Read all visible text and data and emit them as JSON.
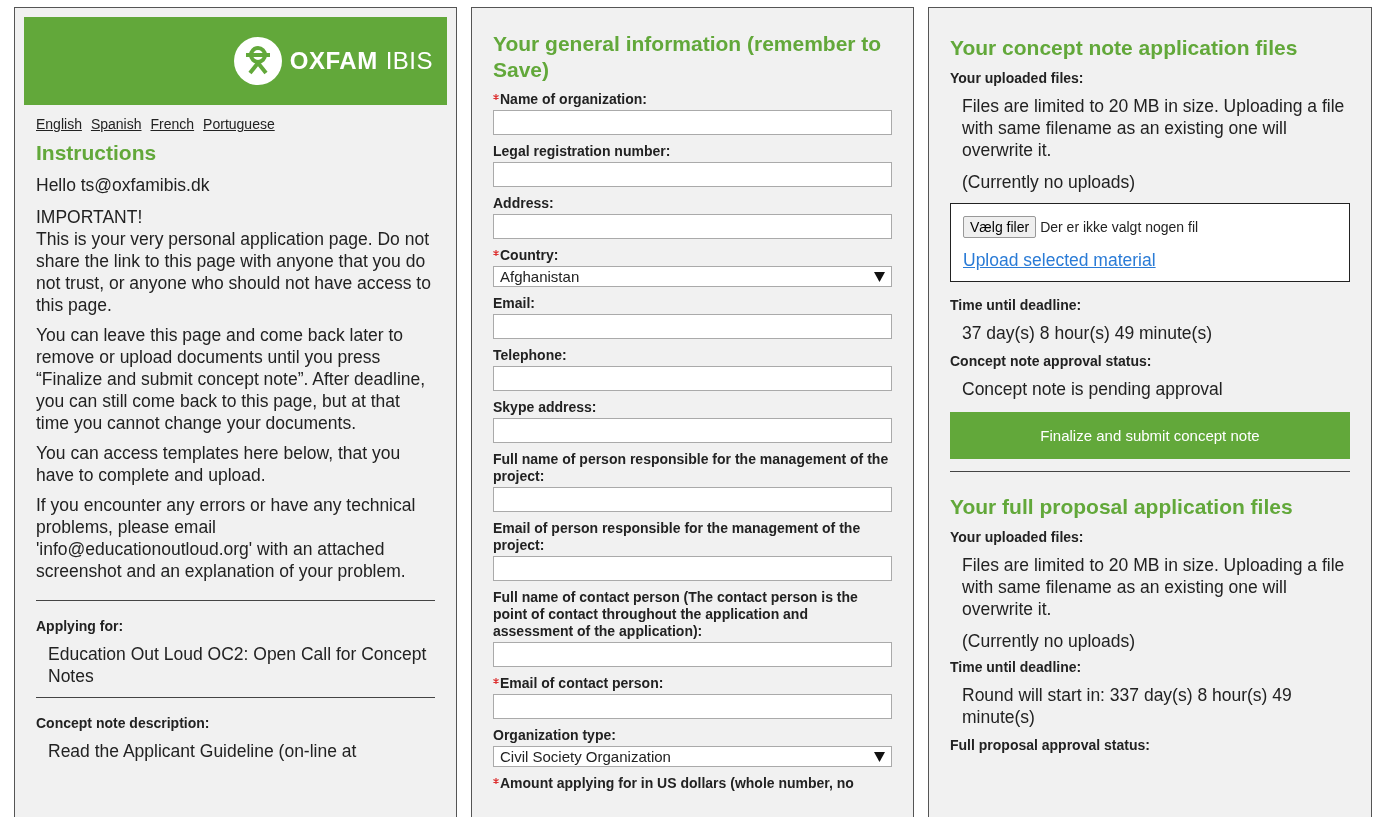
{
  "left": {
    "logo": {
      "word1": "OXFAM",
      "word2": "IBIS"
    },
    "languages": [
      "English",
      "Spanish",
      "French",
      "Portuguese"
    ],
    "heading": "Instructions",
    "greeting": "Hello ts@oxfamibis.dk",
    "important": "IMPORTANT!",
    "paragraphs": [
      "This is your very personal application page. Do not share the link to this page with anyone that you do not trust, or anyone who should not have access to this page.",
      "You can leave this page and come back later to remove or upload documents until you press “Finalize and submit concept note”. After deadline, you can still come back to this page, but at that time you cannot change your documents.",
      "You can access templates here below, that you have to complete and upload.",
      "If you encounter any errors or have any technical problems, please email 'info@educationoutloud.org' with an attached screenshot and an explanation of your problem."
    ],
    "sections": [
      {
        "label": "Applying for:",
        "value": "Education Out Loud OC2: Open Call for Concept Notes"
      },
      {
        "label": "Concept note description:",
        "value": "Read the Applicant Guideline (on-line at"
      }
    ]
  },
  "middle": {
    "heading": "Your general information (remember to Save)",
    "fields": [
      {
        "kind": "text",
        "label": "Name of organization:",
        "required": true
      },
      {
        "kind": "text",
        "label": "Legal registration number:",
        "required": false
      },
      {
        "kind": "text",
        "label": "Address:",
        "required": false
      },
      {
        "kind": "select",
        "label": "Country:",
        "required": true,
        "value": "Afghanistan"
      },
      {
        "kind": "text",
        "label": "Email:",
        "required": false
      },
      {
        "kind": "text",
        "label": "Telephone:",
        "required": false
      },
      {
        "kind": "text",
        "label": "Skype address:",
        "required": false
      },
      {
        "kind": "text",
        "label": "Full name of person responsible for the management of the project:",
        "required": false
      },
      {
        "kind": "text",
        "label": "Email of person responsible for the management of the project:",
        "required": false
      },
      {
        "kind": "text",
        "label": "Full name of contact person (The contact person is the point of contact throughout the application and assessment of the application):",
        "required": false
      },
      {
        "kind": "text",
        "label": "Email of contact person:",
        "required": true
      },
      {
        "kind": "select",
        "label": "Organization type:",
        "required": false,
        "value": "Civil Society Organization"
      },
      {
        "kind": "label",
        "label": "Amount applying for in US dollars (whole number, no",
        "required": true
      }
    ]
  },
  "right": {
    "concept": {
      "heading": "Your concept note application files",
      "uploaded_label": "Your uploaded files:",
      "limit_text": "Files are limited to 20 MB in size. Uploading a file with same filename as an existing one will overwrite it.",
      "uploads": "(Currently no uploads)",
      "upload_box": {
        "choose_button": "Vælg filer",
        "no_file": "Der er ikke valgt nogen fil",
        "upload_link": "Upload selected material"
      },
      "deadline_label": "Time until deadline:",
      "deadline": "37 day(s) 8 hour(s) 49 minute(s)",
      "status_label": "Concept note approval status:",
      "status": "Concept note is pending approval",
      "submit_button": "Finalize and submit concept note"
    },
    "full": {
      "heading": "Your full proposal application files",
      "uploaded_label": "Your uploaded files:",
      "limit_text": "Files are limited to 20 MB in size. Uploading a file with same filename as an existing one will overwrite it.",
      "uploads": "(Currently no uploads)",
      "deadline_label": "Time until deadline:",
      "deadline": "Round will start in: 337 day(s) 8 hour(s) 49 minute(s)",
      "status_label": "Full proposal approval status:"
    }
  }
}
